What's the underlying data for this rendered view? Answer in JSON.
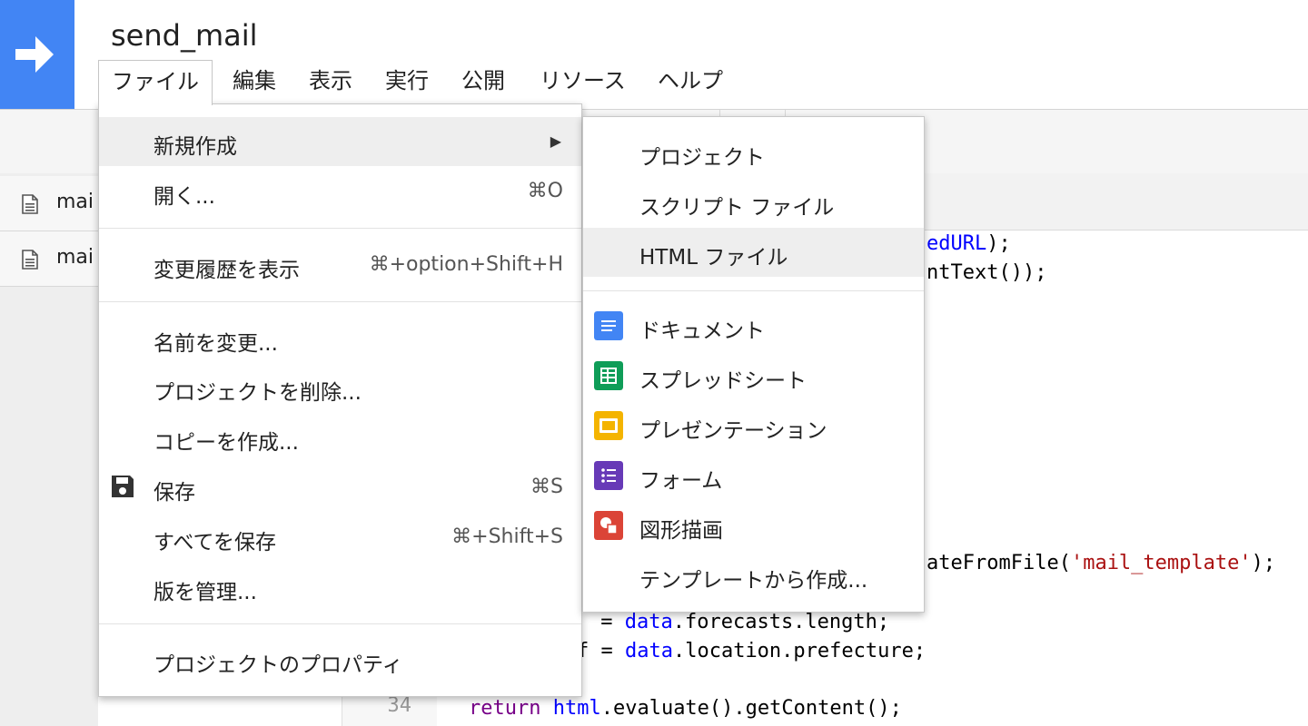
{
  "app": {
    "title": "send_mail",
    "logo_icon": "arrow-right-icon",
    "logo_color": "#4285f4"
  },
  "menubar": [
    {
      "label": "ファイル",
      "active": true
    },
    {
      "label": "編集"
    },
    {
      "label": "表示"
    },
    {
      "label": "実行"
    },
    {
      "label": "公開"
    },
    {
      "label": "リソース"
    },
    {
      "label": "ヘルプ"
    }
  ],
  "files": [
    {
      "name": "mai",
      "icon": "document-icon"
    },
    {
      "name": "mai",
      "icon": "document-icon"
    }
  ],
  "file_menu": {
    "items": [
      {
        "label": "新規作成",
        "arrow": "▶"
      },
      {
        "label": "開く...",
        "shortcut": "⌘O"
      },
      {
        "label": "変更履歴を表示",
        "shortcut": "⌘+option+Shift+H"
      },
      {
        "label": "名前を変更..."
      },
      {
        "label": "プロジェクトを削除..."
      },
      {
        "label": "コピーを作成..."
      },
      {
        "label": "保存",
        "shortcut": "⌘S",
        "icon": "floppy-disk-icon"
      },
      {
        "label": "すべてを保存",
        "shortcut": "⌘+Shift+S"
      },
      {
        "label": "版を管理..."
      },
      {
        "label": "プロジェクトのプロパティ"
      }
    ]
  },
  "new_submenu": {
    "items": [
      {
        "label": "プロジェクト"
      },
      {
        "label": "スクリプト ファイル"
      },
      {
        "label": "HTML ファイル"
      },
      {
        "label": "ドキュメント",
        "icon": "google-docs-icon",
        "color": "#4285f4"
      },
      {
        "label": "スプレッドシート",
        "icon": "google-sheets-icon",
        "color": "#0f9d58"
      },
      {
        "label": "プレゼンテーション",
        "icon": "google-slides-icon",
        "color": "#f4b400"
      },
      {
        "label": "フォーム",
        "icon": "google-forms-icon",
        "color": "#673ab7"
      },
      {
        "label": "図形描画",
        "icon": "google-drawings-icon",
        "color": "#db4437"
      },
      {
        "label": "テンプレートから作成..."
      }
    ]
  },
  "code": {
    "line1": {
      "var": "edURL",
      "rest": ");"
    },
    "line2": {
      "text": "ntText());"
    },
    "line3": {
      "text": "ateFromFile(",
      "str": "'mail_template'",
      "rest": ");"
    },
    "line4": {
      "pre": " = ",
      "var": "data",
      "rest": ".forecasts.length;"
    },
    "line5": {
      "pre": "f = ",
      "var": "data",
      "rest": ".location.prefecture;"
    },
    "line6": {
      "kw": "return",
      "var": "html",
      "rest": ".evaluate().getContent();"
    },
    "line_number": "34"
  }
}
